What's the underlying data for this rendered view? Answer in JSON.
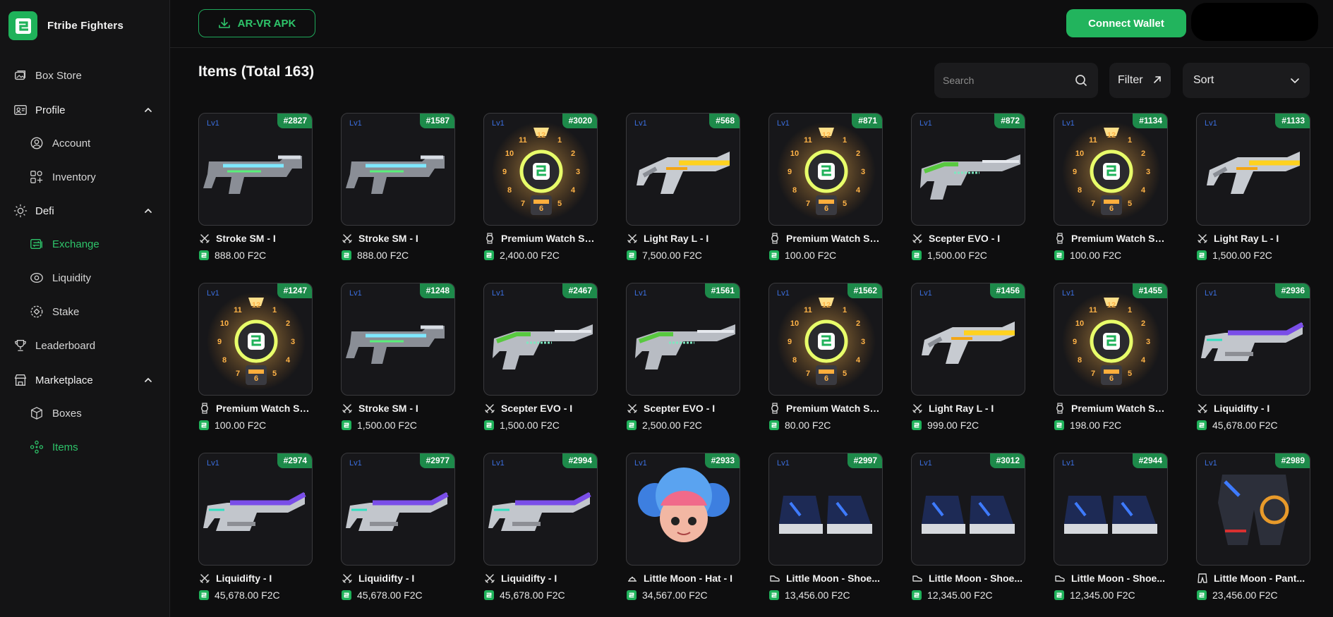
{
  "app": {
    "name": "Ftribe Fighters",
    "logo_glyph": "2",
    "brand_color": "#22b45d"
  },
  "header": {
    "apk_label": "AR-VR APK",
    "connect_label": "Connect Wallet"
  },
  "sidebar": {
    "items": [
      {
        "label": "Box Store",
        "icon": "box-store-icon",
        "level": "top",
        "state": ""
      },
      {
        "label": "Profile",
        "icon": "profile-icon",
        "level": "group",
        "state": "expanded"
      },
      {
        "label": "Account",
        "icon": "account-icon",
        "level": "sub",
        "state": ""
      },
      {
        "label": "Inventory",
        "icon": "inventory-icon",
        "level": "sub",
        "state": ""
      },
      {
        "label": "Defi",
        "icon": "defi-icon",
        "level": "group",
        "state": "expanded"
      },
      {
        "label": "Exchange",
        "icon": "exchange-icon",
        "level": "sub",
        "state": "active"
      },
      {
        "label": "Liquidity",
        "icon": "liquidity-icon",
        "level": "sub",
        "state": ""
      },
      {
        "label": "Stake",
        "icon": "stake-icon",
        "level": "sub",
        "state": ""
      },
      {
        "label": "Leaderboard",
        "icon": "trophy-icon",
        "level": "top",
        "state": ""
      },
      {
        "label": "Marketplace",
        "icon": "marketplace-icon",
        "level": "group",
        "state": "expanded"
      },
      {
        "label": "Boxes",
        "icon": "boxes-icon",
        "level": "sub",
        "state": ""
      },
      {
        "label": "Items",
        "icon": "items-icon",
        "level": "sub",
        "state": "active"
      }
    ]
  },
  "main": {
    "title": "Items (Total 163)",
    "search_placeholder": "Search",
    "filter_label": "Filter",
    "sort_label": "Sort"
  },
  "items": [
    {
      "level": "Lv1",
      "id": "#2827",
      "name": "Stroke SM - I",
      "price": "888.00 F2C",
      "art": "stroke-gun",
      "category": "weapon"
    },
    {
      "level": "Lv1",
      "id": "#1587",
      "name": "Stroke SM - I",
      "price": "888.00 F2C",
      "art": "stroke-gun",
      "category": "weapon"
    },
    {
      "level": "Lv1",
      "id": "#3020",
      "name": "Premium Watch Sh...",
      "price": "2,400.00 F2C",
      "art": "watch",
      "category": "watch"
    },
    {
      "level": "Lv1",
      "id": "#568",
      "name": "Light Ray L - I",
      "price": "7,500.00 F2C",
      "art": "light-gun",
      "category": "weapon"
    },
    {
      "level": "Lv1",
      "id": "#871",
      "name": "Premium Watch Sh...",
      "price": "100.00 F2C",
      "art": "watch",
      "category": "watch"
    },
    {
      "level": "Lv1",
      "id": "#872",
      "name": "Scepter EVO - I",
      "price": "1,500.00 F2C",
      "art": "scepter-gun",
      "category": "weapon"
    },
    {
      "level": "Lv1",
      "id": "#1134",
      "name": "Premium Watch Sh...",
      "price": "100.00 F2C",
      "art": "watch",
      "category": "watch"
    },
    {
      "level": "Lv1",
      "id": "#1133",
      "name": "Light Ray L - I",
      "price": "1,500.00 F2C",
      "art": "light-gun",
      "category": "weapon"
    },
    {
      "level": "Lv1",
      "id": "#1247",
      "name": "Premium Watch Sh...",
      "price": "100.00 F2C",
      "art": "watch",
      "category": "watch"
    },
    {
      "level": "Lv1",
      "id": "#1248",
      "name": "Stroke SM - I",
      "price": "1,500.00 F2C",
      "art": "stroke-gun",
      "category": "weapon"
    },
    {
      "level": "Lv1",
      "id": "#2467",
      "name": "Scepter EVO - I",
      "price": "1,500.00 F2C",
      "art": "scepter-gun",
      "category": "weapon"
    },
    {
      "level": "Lv1",
      "id": "#1561",
      "name": "Scepter EVO - I",
      "price": "2,500.00 F2C",
      "art": "scepter-gun",
      "category": "weapon"
    },
    {
      "level": "Lv1",
      "id": "#1562",
      "name": "Premium Watch Sh...",
      "price": "80.00 F2C",
      "art": "watch",
      "category": "watch"
    },
    {
      "level": "Lv1",
      "id": "#1456",
      "name": "Light Ray L - I",
      "price": "999.00 F2C",
      "art": "light-gun",
      "category": "weapon"
    },
    {
      "level": "Lv1",
      "id": "#1455",
      "name": "Premium Watch Sh...",
      "price": "198.00 F2C",
      "art": "watch",
      "category": "watch"
    },
    {
      "level": "Lv1",
      "id": "#2936",
      "name": "Liquidifty - I",
      "price": "45,678.00 F2C",
      "art": "liquid-gun",
      "category": "weapon"
    },
    {
      "level": "Lv1",
      "id": "#2974",
      "name": "Liquidifty - I",
      "price": "45,678.00 F2C",
      "art": "liquid-gun",
      "category": "weapon"
    },
    {
      "level": "Lv1",
      "id": "#2977",
      "name": "Liquidifty - I",
      "price": "45,678.00 F2C",
      "art": "liquid-gun",
      "category": "weapon"
    },
    {
      "level": "Lv1",
      "id": "#2994",
      "name": "Liquidifty - I",
      "price": "45,678.00 F2C",
      "art": "liquid-gun",
      "category": "weapon"
    },
    {
      "level": "Lv1",
      "id": "#2933",
      "name": "Little Moon - Hat - I",
      "price": "34,567.00 F2C",
      "art": "hat",
      "category": "hat"
    },
    {
      "level": "Lv1",
      "id": "#2997",
      "name": "Little Moon - Shoe...",
      "price": "13,456.00 F2C",
      "art": "shoes",
      "category": "shoe"
    },
    {
      "level": "Lv1",
      "id": "#3012",
      "name": "Little Moon - Shoe...",
      "price": "12,345.00 F2C",
      "art": "shoes",
      "category": "shoe"
    },
    {
      "level": "Lv1",
      "id": "#2944",
      "name": "Little Moon - Shoe...",
      "price": "12,345.00 F2C",
      "art": "shoes",
      "category": "shoe"
    },
    {
      "level": "Lv1",
      "id": "#2989",
      "name": "Little Moon - Pant...",
      "price": "23,456.00 F2C",
      "art": "pants",
      "category": "pants"
    }
  ]
}
